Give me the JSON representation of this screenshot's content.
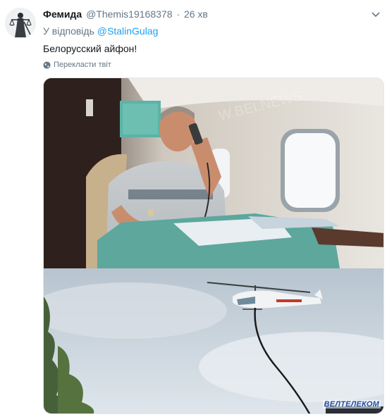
{
  "tweet": {
    "display_name": "Фемида",
    "handle": "@Themis19168378",
    "separator": "·",
    "time": "26 хв",
    "reply_prefix": "У відповідь ",
    "reply_handle": "@StalinGulag",
    "text": "Белорусский айфон!",
    "translate_label": "Перекласти твіт"
  },
  "media": {
    "watermark": "ВЕЛТЕЛЕКОМ"
  },
  "icons": {
    "caret": "chevron-down-icon",
    "translate": "globe-icon",
    "avatar": "themis-statue"
  },
  "colors": {
    "link": "#1da1f2",
    "muted": "#657786",
    "text": "#14171a"
  }
}
